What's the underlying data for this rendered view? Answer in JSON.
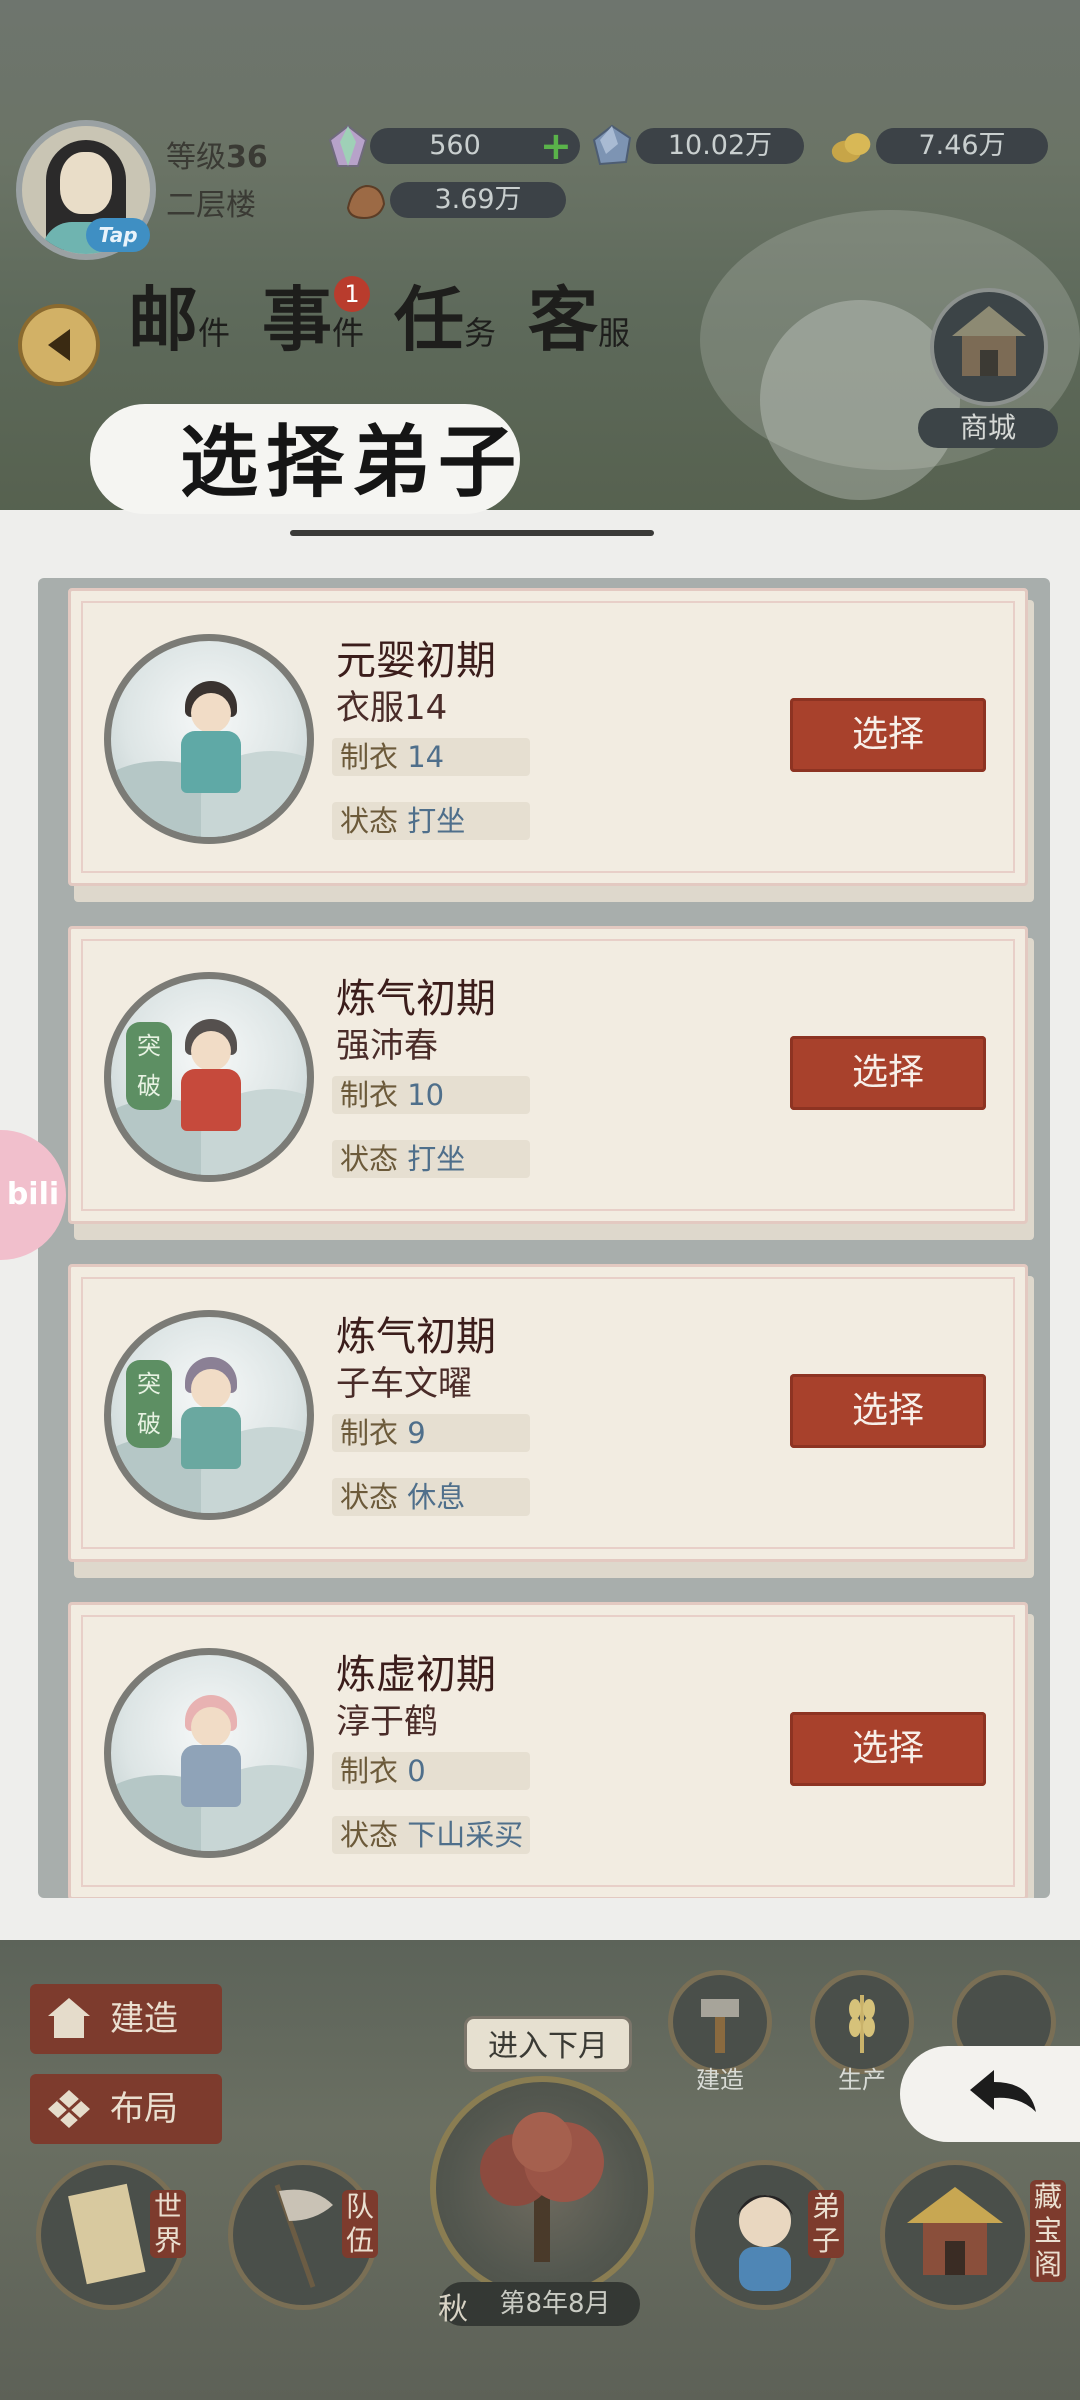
{
  "header": {
    "avatar_badge": "Tap",
    "level_label": "等级",
    "level_value": "36",
    "location": "二层楼",
    "resources": {
      "spirit_stone": "560",
      "crystal": "10.02万",
      "gold": "7.46万",
      "ore": "3.69万"
    }
  },
  "tabs": [
    {
      "big": "邮",
      "small": "件"
    },
    {
      "big": "事",
      "small": "件",
      "badge": "1"
    },
    {
      "big": "任",
      "small": "务"
    },
    {
      "big": "客",
      "small": "服"
    }
  ],
  "shop_label": "商城",
  "dialog": {
    "title": "选择弟子",
    "select_label": "选择",
    "stat_labels": {
      "tailoring": "制衣",
      "status": "状态"
    },
    "breakthrough_label": "突破",
    "disciples": [
      {
        "realm": "元婴初期",
        "name": "衣服14",
        "tailoring": "14",
        "status": "打坐",
        "breakthrough": false,
        "robe": "#5fa9a6",
        "hair": "#3a3330"
      },
      {
        "realm": "炼气初期",
        "name": "强沛春",
        "tailoring": "10",
        "status": "打坐",
        "breakthrough": true,
        "robe": "#c64a3c",
        "hair": "#55504e"
      },
      {
        "realm": "炼气初期",
        "name": "子车文曜",
        "tailoring": "9",
        "status": "休息",
        "breakthrough": true,
        "robe": "#6aa8a0",
        "hair": "#8b8095"
      },
      {
        "realm": "炼虚初期",
        "name": "淳于鹤",
        "tailoring": "0",
        "status": "下山采买",
        "breakthrough": false,
        "robe": "#8fa3b8",
        "hair": "#e8b2b2"
      }
    ]
  },
  "bottom": {
    "build": "建造",
    "layout": "布局",
    "build_small": "建造",
    "produce_small": "生产",
    "next_month": "进入下月",
    "season": "秋",
    "date": "第8年8月",
    "world": [
      "世",
      "界"
    ],
    "team": [
      "队",
      "伍"
    ],
    "disciple": [
      "弟",
      "子"
    ],
    "treasure": [
      "藏",
      "宝",
      "阁"
    ]
  },
  "bili_tab": "bili"
}
